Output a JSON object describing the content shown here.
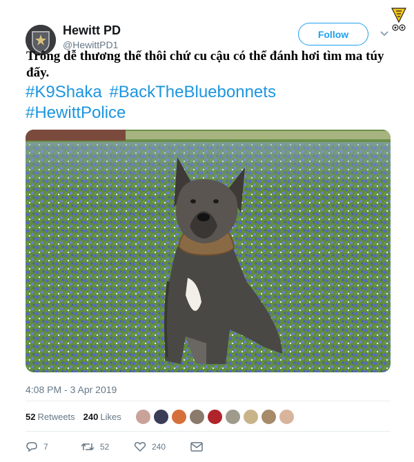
{
  "tweet": {
    "author_name": "Hewitt PD",
    "author_handle": "@HewittPD1",
    "follow_label": "Follow",
    "caption": "Trông dễ thương thế thôi chứ cu cậu có thể đánh hơi tìm ma túy đấy.",
    "hashtags": [
      "#K9Shaka",
      "#BackTheBluebonnets",
      "#HewittPolice"
    ],
    "timestamp": "4:08 PM - 3 Apr 2019",
    "retweets_count": "52",
    "retweets_label": "Retweets",
    "likes_count": "240",
    "likes_label": "Likes",
    "reply_count": "7",
    "retweet_action_count": "52",
    "like_action_count": "240"
  },
  "icons": {
    "reply": "reply-icon",
    "retweet": "retweet-icon",
    "like": "heart-icon",
    "dm": "envelope-icon",
    "more": "chevron-down-icon"
  },
  "colors": {
    "link": "#1b95e0",
    "follow": "#1da1f2",
    "muted": "#657786",
    "text": "#14171a"
  },
  "liker_avatars": [
    "#c9a39a",
    "#3a3d55",
    "#d5703b",
    "#8a7b6c",
    "#b1242a",
    "#9e9a8c",
    "#c9b48a",
    "#a68a6a",
    "#d8b49c"
  ]
}
